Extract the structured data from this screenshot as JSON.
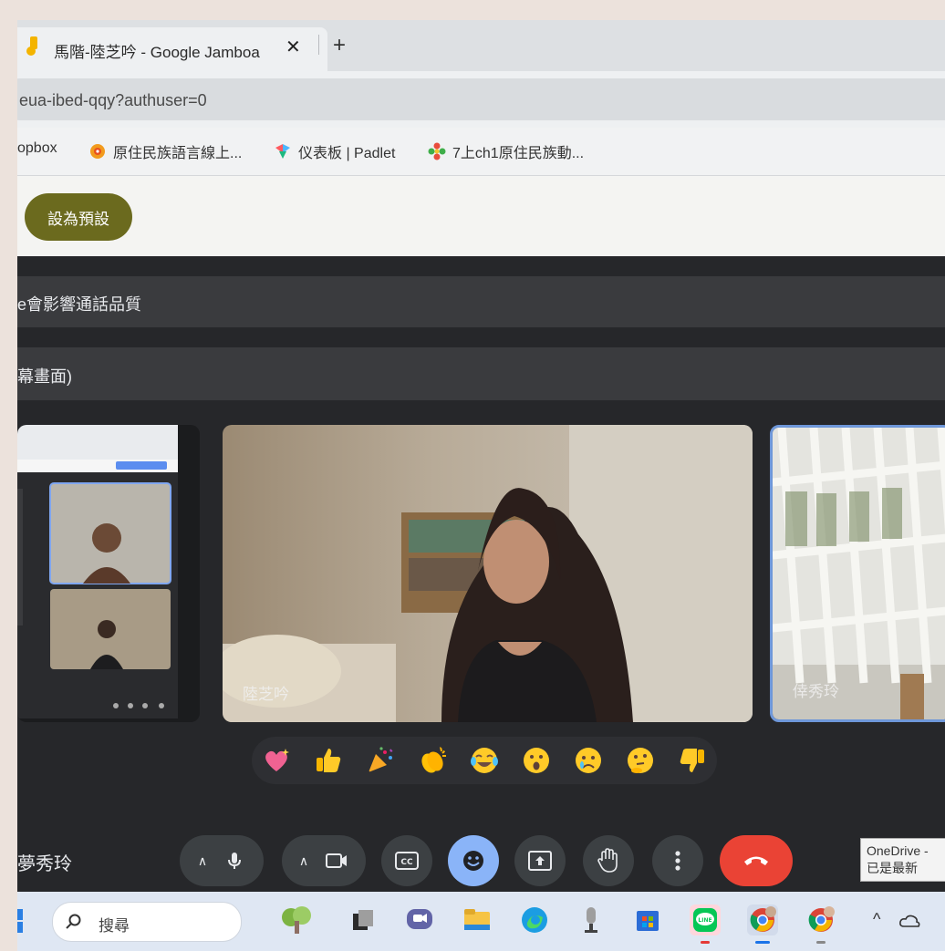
{
  "browser": {
    "tab_title": "馬階-陸芝吟 - Google Jamboa",
    "tab_close": "✕",
    "new_tab": "+",
    "url": "eua-ibed-qqy?authuser=0",
    "bookmarks": [
      {
        "label": "opbox"
      },
      {
        "label": "原住民族語言線上..."
      },
      {
        "label": "仪表板 | Padlet"
      },
      {
        "label": "7上ch1原住民族動..."
      }
    ]
  },
  "page": {
    "default_button": "設為預設"
  },
  "meet": {
    "notice_1": "e會影響通話品質",
    "notice_2": "幕畫面)",
    "participants": [
      {
        "name": "陸芝吟"
      },
      {
        "name": "倖秀玲"
      }
    ],
    "self_name": "夢秀玲",
    "reactions": [
      "sparkling-heart",
      "thumbs-up",
      "party-popper",
      "clapping-hands",
      "tears-of-joy",
      "surprised-face",
      "crying-face",
      "thinking-face",
      "thumbs-down"
    ],
    "controls": [
      "mic",
      "camera",
      "captions",
      "emoji",
      "present",
      "raise-hand",
      "more",
      "end-call"
    ],
    "end_call_color": "#ea4335",
    "emoji_active_color": "#8ab4f8"
  },
  "notification": {
    "line1": "OneDrive -",
    "line2": "已是最新"
  },
  "taskbar": {
    "search_placeholder": "搜尋",
    "tray_chevron": "^"
  }
}
